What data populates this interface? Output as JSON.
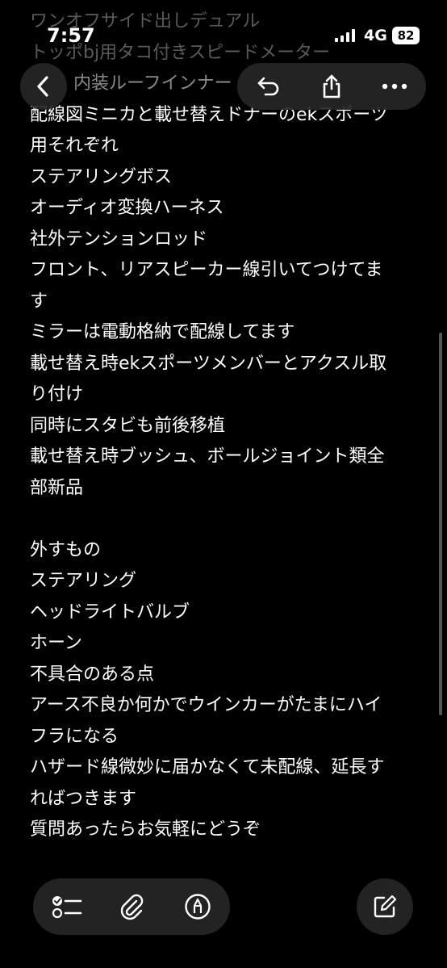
{
  "status_bar": {
    "time": "7:57",
    "network": "4G",
    "battery": "82"
  },
  "note": {
    "lines": [
      "ワンオフサイド出しデュアル",
      "トッポbj用タコ付きスピードメーター",
      "内装ルーフインナー",
      "配線図ミニカと載せ替えドナーのekスポーツ",
      "用それぞれ",
      "ステアリングボス",
      "オーディオ変換ハーネス",
      "社外テンションロッド",
      "フロント、リアスピーカー線引いてつけてま",
      "す",
      "ミラーは電動格納で配線してます",
      "載せ替え時ekスポーツメンバーとアクスル取",
      "り付け",
      "同時にスタビも前後移植",
      "載せ替え時ブッシュ、ボールジョイント類全",
      "部新品",
      "",
      "外すもの",
      "ステアリング",
      "ヘッドライトバルブ",
      "ホーン",
      "不具合のある点",
      "アース不良か何かでウインカーがたまにハイ",
      "フラになる",
      "ハザード線微妙に届かなくて未配線、延長す",
      "ればつきます",
      "質問あったらお気軽にどうぞ"
    ]
  },
  "toolbar": {
    "top": {
      "back_icon": "chevron-left-icon",
      "undo_icon": "undo-icon",
      "share_icon": "share-icon",
      "more_icon": "ellipsis-icon"
    },
    "bottom": {
      "checklist_icon": "checklist-icon",
      "attachment_icon": "paperclip-icon",
      "markup_icon": "pen-circle-icon",
      "compose_icon": "compose-icon"
    }
  },
  "colors": {
    "background": "#000000",
    "text": "#ffffff",
    "button_bg": "#262626"
  }
}
